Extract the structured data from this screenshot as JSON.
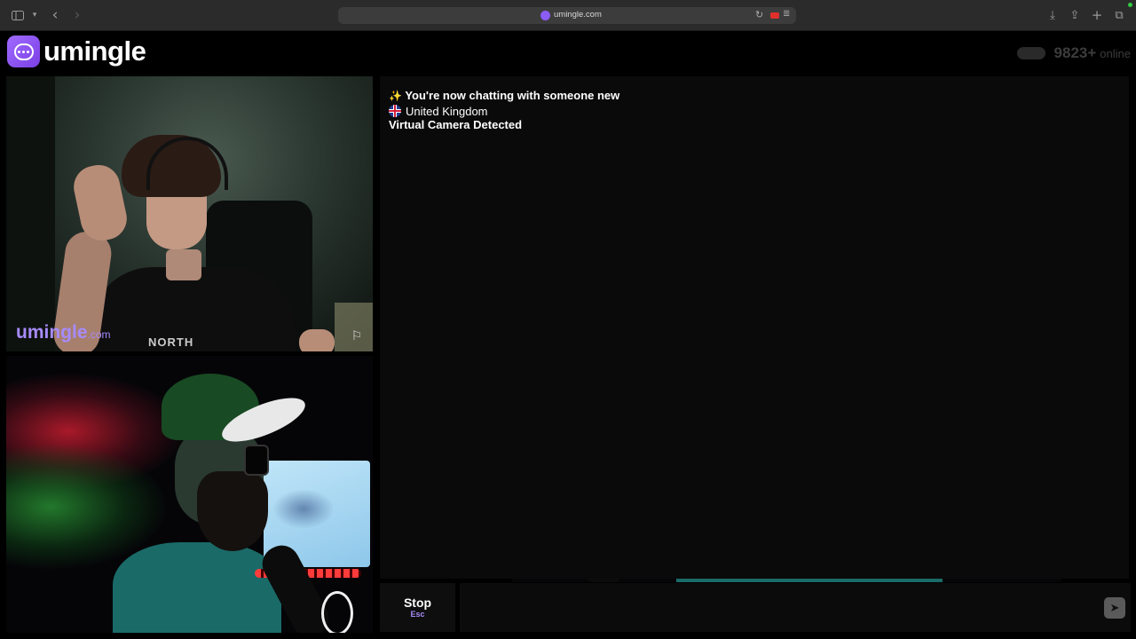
{
  "browser": {
    "url": "umingle.com",
    "icons": {
      "sidebar": "sidebar-icon",
      "back": "‹",
      "forward": "›",
      "reload": "↻",
      "reader": "≣",
      "download": "⤓",
      "share": "⇪",
      "new_tab": "+",
      "tabs": "⧉"
    }
  },
  "site": {
    "logo_text": "umingle",
    "online_count": "9823+",
    "online_label": "online"
  },
  "stranger_video": {
    "watermark": "umingle",
    "watermark_suffix": ".com",
    "shirt_text": "NORTH",
    "report_icon": "⚐"
  },
  "chat": {
    "messages": [
      {
        "icon": "✨",
        "text": "You're now chatting with someone new"
      },
      {
        "flag": "uk-flag-icon",
        "text": "United Kingdom"
      },
      {
        "text": "Virtual Camera Detected"
      }
    ]
  },
  "controls": {
    "stop_label": "Stop",
    "stop_key": "Esc",
    "message_placeholder": "",
    "send_icon": "➤"
  },
  "colors": {
    "brand": "#8b5cf6",
    "watermark": "#a78bfa",
    "background": "#000000"
  }
}
